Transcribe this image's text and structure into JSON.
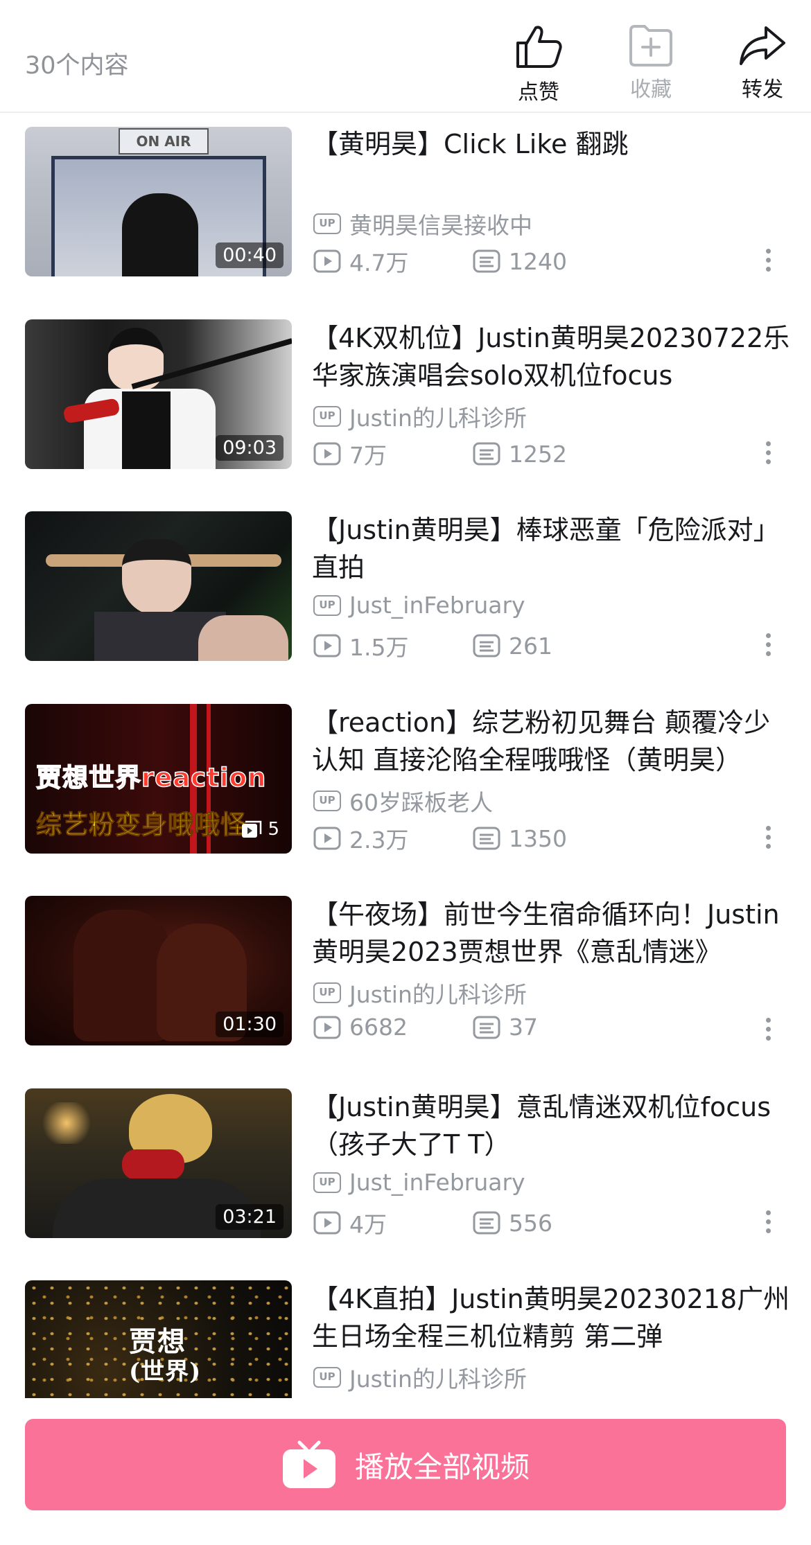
{
  "header": {
    "count": "30个内容",
    "actions": {
      "like": "点赞",
      "favorite": "收藏",
      "share": "转发"
    }
  },
  "videos": [
    {
      "title": "【黄明昊】Click  Like  翻跳",
      "uploader": "黄明昊信昊接收中",
      "views": "4.7万",
      "danmaku": "1240",
      "duration": "00:40"
    },
    {
      "title": "【4K双机位】Justin黄明昊20230722乐华家族演唱会solo双机位focus",
      "uploader": "Justin的儿科诊所",
      "views": "7万",
      "danmaku": "1252",
      "duration": "09:03"
    },
    {
      "title": "【Justin黄明昊】棒球恶童「危险派对」直拍",
      "uploader": "Just_inFebruary",
      "views": "1.5万",
      "danmaku": "261",
      "duration": ""
    },
    {
      "title": "【reaction】综艺粉初见舞台  颠覆冷少认知  直接沦陷全程哦哦怪（黄明昊）",
      "uploader": "60岁踩板老人",
      "views": "2.3万",
      "danmaku": "1350",
      "duration": "5",
      "cover_line1": "贾想世界reaction",
      "cover_line2": "综艺粉变身哦哦怪"
    },
    {
      "title": "【午夜场】前世今生宿命循环向！Justin黄明昊2023贾想世界《意乱情迷》",
      "uploader": "Justin的儿科诊所",
      "views": "6682",
      "danmaku": "37",
      "duration": "01:30"
    },
    {
      "title": "【Justin黄明昊】意乱情迷双机位focus（孩子大了T  T）",
      "uploader": "Just_inFebruary",
      "views": "4万",
      "danmaku": "556",
      "duration": "03:21"
    },
    {
      "title": "【4K直拍】Justin黄明昊20230218广州生日场全程三机位精剪  第二弹",
      "uploader": "Justin的儿科诊所",
      "views": "",
      "danmaku": "",
      "duration": "",
      "cover_line1": "贾想",
      "cover_line2": "(世界)"
    }
  ],
  "play_all": "播放全部视频",
  "up_badge": "UP",
  "colors": {
    "accent": "#fb7299",
    "muted": "#9499a0"
  }
}
